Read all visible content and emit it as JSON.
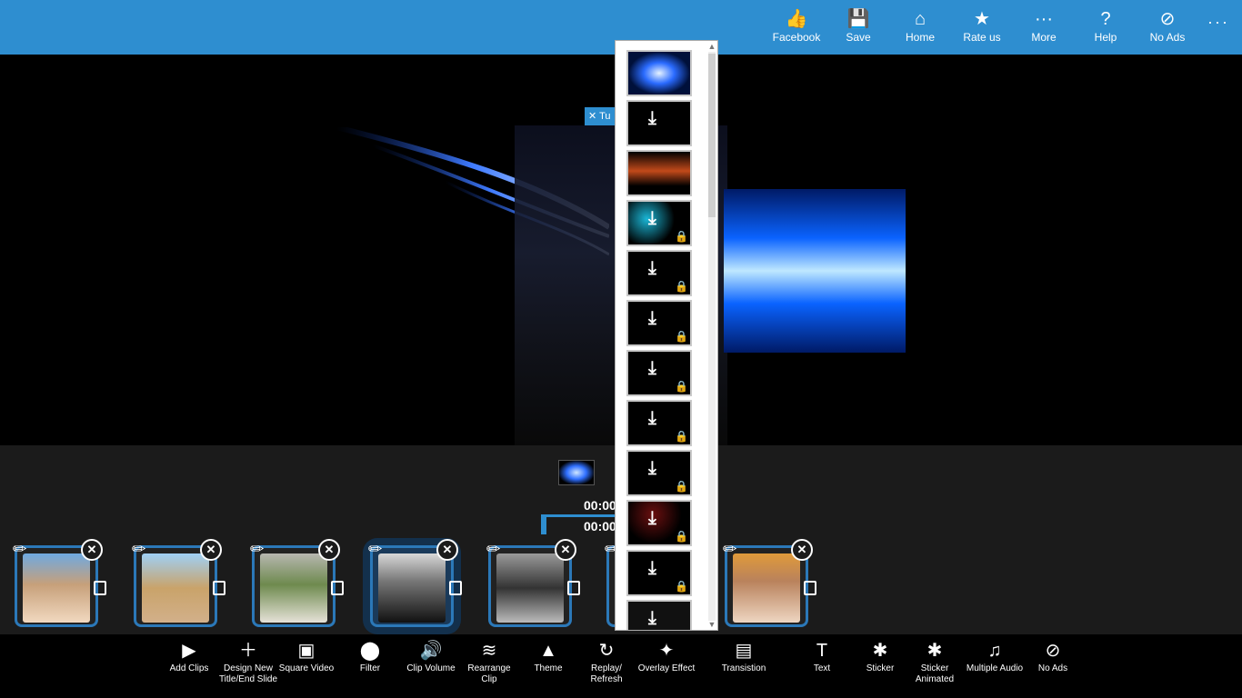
{
  "topbar": {
    "buttons": [
      {
        "label": "Facebook",
        "icon": "thumbs-up-icon",
        "glyph": "👍"
      },
      {
        "label": "Save",
        "icon": "save-icon",
        "glyph": "💾"
      },
      {
        "label": "Home",
        "icon": "home-icon",
        "glyph": "⌂"
      },
      {
        "label": "Rate us",
        "icon": "star-icon",
        "glyph": "★"
      },
      {
        "label": "More",
        "icon": "more-icon",
        "glyph": "···"
      },
      {
        "label": "Help",
        "icon": "help-icon",
        "glyph": "?"
      },
      {
        "label": "No Ads",
        "icon": "no-ads-icon",
        "glyph": "⊘"
      }
    ],
    "overflow": "···"
  },
  "preview": {
    "chip_text": "Tu"
  },
  "timeline": {
    "time_1": "00:00",
    "time_2": "00:00",
    "clips": [
      {
        "name": "clip-1",
        "gradient": "linear-gradient(180deg,#6fa9e0 0%,#c7a07a 45%,#f1d9c0 100%)"
      },
      {
        "name": "clip-2",
        "gradient": "linear-gradient(180deg,#9fd0f5 0%,#c9a36a 50%,#d2b08a 100%)"
      },
      {
        "name": "clip-3",
        "gradient": "linear-gradient(180deg,#b7b7b0 0%,#6e8a4e 45%,#e6e2d8 100%)"
      },
      {
        "name": "clip-4",
        "gradient": "linear-gradient(180deg,#d8d8d8 0%,#777 40%,#111 100%)"
      },
      {
        "name": "clip-5",
        "gradient": "linear-gradient(180deg,#9a9a9a 0%,#333 50%,#bbb 100%)"
      },
      {
        "name": "clip-6",
        "gradient": "linear-gradient(180deg,#4a4a4a 0%,#222 100%)"
      },
      {
        "name": "clip-7",
        "gradient": "linear-gradient(180deg,#e09a3a 0%,#b9825c 40%,#eed6c2 100%)"
      }
    ]
  },
  "toolbar": {
    "tools": [
      {
        "label": "Add Clips",
        "icon": "add-clips-icon",
        "glyph": "▶"
      },
      {
        "label": "Design New Title/End Slide",
        "icon": "design-title-icon",
        "glyph": "＋"
      },
      {
        "label": "Square Video",
        "icon": "square-video-icon",
        "glyph": "▣"
      },
      {
        "label": "Filter",
        "icon": "filter-icon",
        "glyph": "⬤"
      },
      {
        "label": "Clip Volume",
        "icon": "clip-volume-icon",
        "glyph": "🔊"
      },
      {
        "label": "Rearrange Clip",
        "icon": "rearrange-icon",
        "glyph": "≋"
      },
      {
        "label": "Theme",
        "icon": "theme-icon",
        "glyph": "▲"
      },
      {
        "label": "Replay/ Refresh",
        "icon": "refresh-icon",
        "glyph": "↻"
      },
      {
        "label": "Overlay Effect",
        "icon": "overlay-effect-icon",
        "glyph": "✦"
      },
      {
        "label": "Transistion",
        "icon": "transition-icon",
        "glyph": "▤"
      },
      {
        "label": "Text",
        "icon": "text-icon",
        "glyph": "T"
      },
      {
        "label": "Sticker",
        "icon": "sticker-icon",
        "glyph": "✱"
      },
      {
        "label": "Sticker Animated",
        "icon": "sticker-animated-icon",
        "glyph": "✱"
      },
      {
        "label": "Multiple Audio",
        "icon": "multiple-audio-icon",
        "glyph": "♫"
      },
      {
        "label": "No Ads",
        "icon": "no-ads-icon",
        "glyph": "⊘"
      }
    ]
  },
  "overlay_panel": {
    "items": [
      {
        "name": "overlay-blue-ring",
        "download": false,
        "lock": false,
        "bg": "radial-gradient(ellipse at center,#e5f2ff 0%,#2a6bff 35%,#00103a 70%)"
      },
      {
        "name": "overlay-download",
        "download": true,
        "lock": false,
        "bg": "#000"
      },
      {
        "name": "overlay-orange-flare",
        "download": false,
        "lock": false,
        "bg": "linear-gradient(180deg,#000 0%,#c24a1a 45%,#000 80%)"
      },
      {
        "name": "overlay-cyan-spark",
        "download": true,
        "lock": true,
        "bg": "radial-gradient(circle at 30% 40%,#1ab6d6 0%,#000 55%)"
      },
      {
        "name": "overlay-locked",
        "download": true,
        "lock": true,
        "bg": "#000"
      },
      {
        "name": "overlay-locked",
        "download": true,
        "lock": true,
        "bg": "#000"
      },
      {
        "name": "overlay-locked",
        "download": true,
        "lock": true,
        "bg": "#000"
      },
      {
        "name": "overlay-locked",
        "download": true,
        "lock": true,
        "bg": "#000"
      },
      {
        "name": "overlay-locked",
        "download": true,
        "lock": true,
        "bg": "#000"
      },
      {
        "name": "overlay-red-sparkle",
        "download": true,
        "lock": true,
        "bg": "radial-gradient(circle at 40% 30%,#6a0f0f 0%,#000 60%)"
      },
      {
        "name": "overlay-locked",
        "download": true,
        "lock": true,
        "bg": "#000"
      },
      {
        "name": "overlay-dust",
        "download": true,
        "lock": false,
        "bg": "#111"
      }
    ]
  },
  "colors": {
    "accent": "#2e8ed0",
    "toolbar_bg": "#000000",
    "timeline_bg": "#1b1b1b"
  }
}
